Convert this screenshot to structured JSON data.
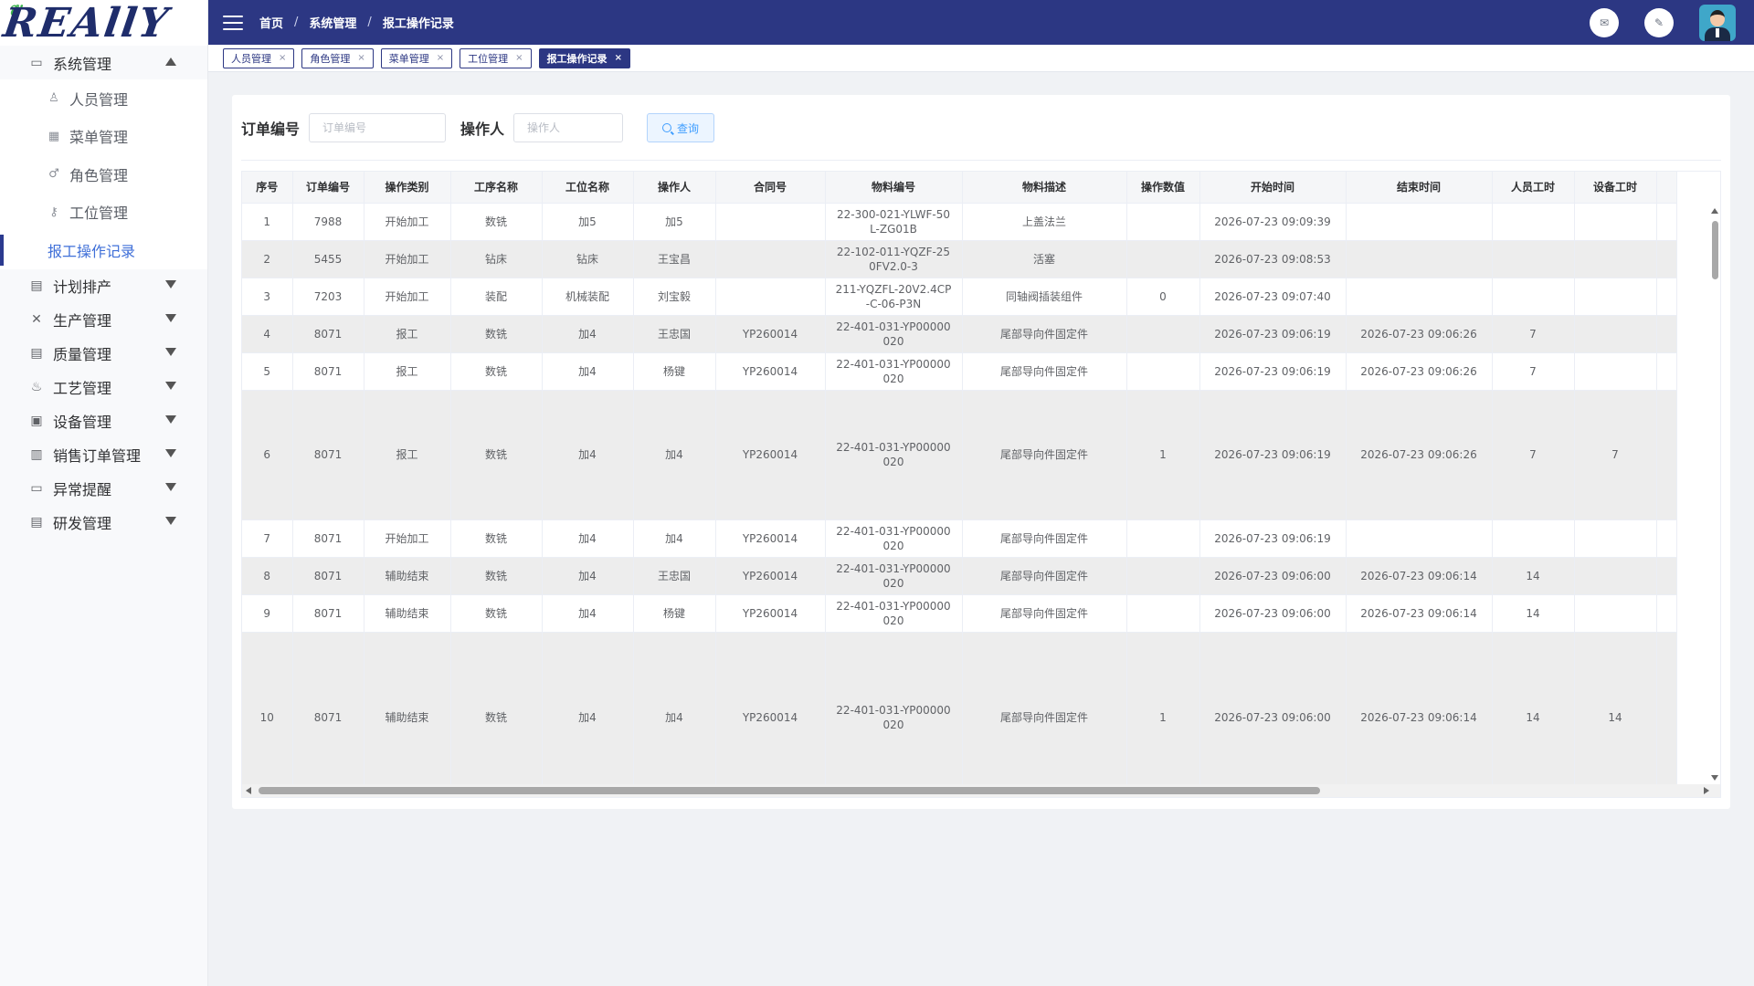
{
  "logo_text": "REAllY",
  "header": {
    "breadcrumbs": [
      "首页",
      "系统管理",
      "报工操作记录"
    ],
    "icons": [
      "menu-icon",
      "mail-icon",
      "edit-icon",
      "user-avatar"
    ]
  },
  "tabs": [
    {
      "label": "人员管理",
      "active": false
    },
    {
      "label": "角色管理",
      "active": false
    },
    {
      "label": "菜单管理",
      "active": false
    },
    {
      "label": "工位管理",
      "active": false
    },
    {
      "label": "报工操作记录",
      "active": true
    }
  ],
  "sidebar": {
    "groups": [
      {
        "label": "系统管理",
        "icon": "monitor-icon",
        "expanded": true,
        "items": [
          {
            "label": "人员管理",
            "icon": "person-icon",
            "active": false
          },
          {
            "label": "菜单管理",
            "icon": "grid-icon",
            "active": false
          },
          {
            "label": "角色管理",
            "icon": "user-icon",
            "active": false
          },
          {
            "label": "工位管理",
            "icon": "key-icon",
            "active": false
          },
          {
            "label": "报工操作记录",
            "icon": "",
            "active": true
          }
        ]
      },
      {
        "label": "计划排产",
        "icon": "calendar-icon",
        "expanded": false,
        "items": []
      },
      {
        "label": "生产管理",
        "icon": "tools-icon",
        "expanded": false,
        "items": []
      },
      {
        "label": "质量管理",
        "icon": "document-icon",
        "expanded": false,
        "items": []
      },
      {
        "label": "工艺管理",
        "icon": "flask-icon",
        "expanded": false,
        "items": []
      },
      {
        "label": "设备管理",
        "icon": "device-icon",
        "expanded": false,
        "items": []
      },
      {
        "label": "销售订单管理",
        "icon": "order-icon",
        "expanded": false,
        "items": []
      },
      {
        "label": "异常提醒",
        "icon": "alert-icon",
        "expanded": false,
        "items": []
      },
      {
        "label": "研发管理",
        "icon": "research-icon",
        "expanded": false,
        "items": []
      }
    ]
  },
  "filters": {
    "order_label": "订单编号",
    "order_placeholder": "订单编号",
    "operator_label": "操作人",
    "operator_placeholder": "操作人",
    "search_label": "查询"
  },
  "table": {
    "columns": [
      "序号",
      "订单编号",
      "操作类别",
      "工序名称",
      "工位名称",
      "操作人",
      "合同号",
      "物料编号",
      "物料描述",
      "操作数值",
      "开始时间",
      "结束时间",
      "人员工时",
      "设备工时"
    ],
    "rows": [
      [
        "1",
        "7988",
        "开始加工",
        "数铣",
        "加5",
        "加5",
        "",
        "22-300-021-YLWF-50L-ZG01B",
        "上盖法兰",
        "",
        "2026-07-23 09:09:39",
        "",
        "",
        ""
      ],
      [
        "2",
        "5455",
        "开始加工",
        "钻床",
        "钻床",
        "王宝昌",
        "",
        "22-102-011-YQZF-250FV2.0-3",
        "活塞",
        "",
        "2026-07-23 09:08:53",
        "",
        "",
        ""
      ],
      [
        "3",
        "7203",
        "开始加工",
        "装配",
        "机械装配",
        "刘宝毅",
        "",
        "211-YQZFL-20V2.4CP-C-06-P3N",
        "同轴阀插装组件",
        "0",
        "2026-07-23 09:07:40",
        "",
        "",
        ""
      ],
      [
        "4",
        "8071",
        "报工",
        "数铣",
        "加4",
        "王忠国",
        "YP260014",
        "22-401-031-YP00000020",
        "尾部导向件固定件",
        "",
        "2026-07-23 09:06:19",
        "2026-07-23 09:06:26",
        "7",
        ""
      ],
      [
        "5",
        "8071",
        "报工",
        "数铣",
        "加4",
        "杨键",
        "YP260014",
        "22-401-031-YP00000020",
        "尾部导向件固定件",
        "",
        "2026-07-23 09:06:19",
        "2026-07-23 09:06:26",
        "7",
        ""
      ],
      [
        "6",
        "8071",
        "报工",
        "数铣",
        "加4",
        "加4",
        "YP260014",
        "22-401-031-YP00000020",
        "尾部导向件固定件",
        "1",
        "2026-07-23 09:06:19",
        "2026-07-23 09:06:26",
        "7",
        "7"
      ],
      [
        "7",
        "8071",
        "开始加工",
        "数铣",
        "加4",
        "加4",
        "YP260014",
        "22-401-031-YP00000020",
        "尾部导向件固定件",
        "",
        "2026-07-23 09:06:19",
        "",
        "",
        ""
      ],
      [
        "8",
        "8071",
        "辅助结束",
        "数铣",
        "加4",
        "王忠国",
        "YP260014",
        "22-401-031-YP00000020",
        "尾部导向件固定件",
        "",
        "2026-07-23 09:06:00",
        "2026-07-23 09:06:14",
        "14",
        ""
      ],
      [
        "9",
        "8071",
        "辅助结束",
        "数铣",
        "加4",
        "杨键",
        "YP260014",
        "22-401-031-YP00000020",
        "尾部导向件固定件",
        "",
        "2026-07-23 09:06:00",
        "2026-07-23 09:06:14",
        "14",
        ""
      ],
      [
        "10",
        "8071",
        "辅助结束",
        "数铣",
        "加4",
        "加4",
        "YP260014",
        "22-401-031-YP00000020",
        "尾部导向件固定件",
        "1",
        "2026-07-23 09:06:00",
        "2026-07-23 09:06:14",
        "14",
        "14"
      ]
    ]
  },
  "colors": {
    "primary": "#2c3783",
    "accent": "#409eff",
    "active_menu": "#3f6fd8",
    "zebra": "#ededed"
  }
}
